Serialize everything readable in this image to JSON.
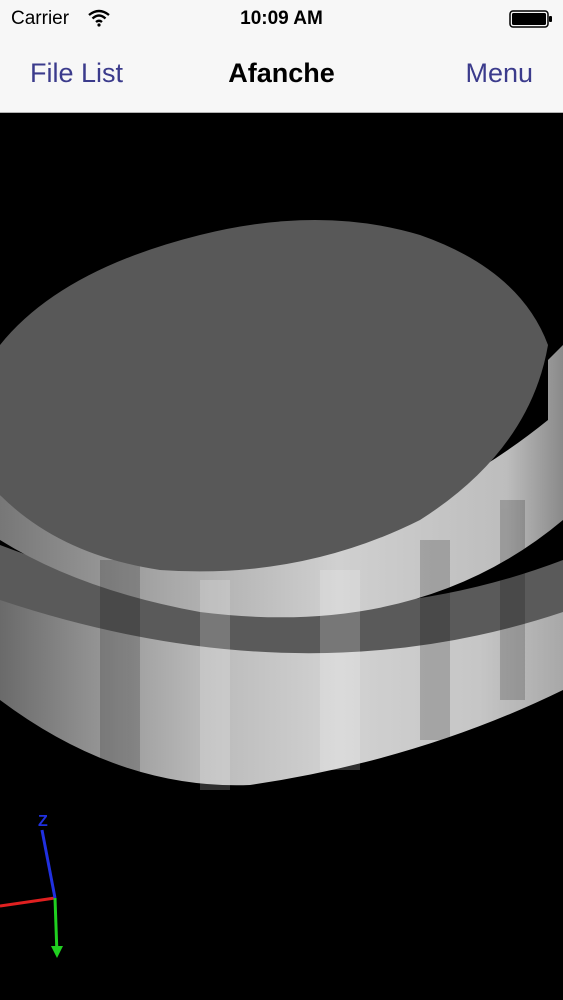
{
  "status_bar": {
    "carrier": "Carrier",
    "time": "10:09 AM",
    "wifi_icon": "wifi-icon",
    "battery_icon": "battery-icon"
  },
  "nav_bar": {
    "left_label": "File List",
    "title": "Afanche",
    "right_label": "Menu"
  },
  "viewer": {
    "background": "#000000",
    "model_color": "#585858",
    "axis_triad": {
      "z_label": "Z",
      "x_color": "#e02020",
      "y_color": "#20d020",
      "z_color": "#2030e0"
    }
  },
  "colors": {
    "accent": "#3b3b8c",
    "bar_background": "#f7f7f7"
  }
}
